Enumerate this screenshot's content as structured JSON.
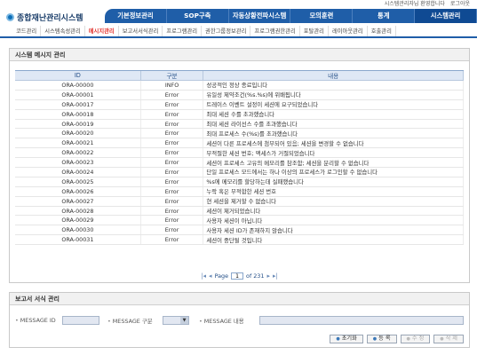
{
  "top_links": [
    "시스템관리자님 환영합니다",
    "로그아웃"
  ],
  "app_title": "종합재난관리시스템",
  "main_nav": [
    {
      "label": "기본정보관리",
      "active": false
    },
    {
      "label": "SOP구축",
      "active": false
    },
    {
      "label": "자동상황전파시스템",
      "active": false
    },
    {
      "label": "모의훈련",
      "active": false
    },
    {
      "label": "통계",
      "active": false
    },
    {
      "label": "시스템관리",
      "active": true
    }
  ],
  "sub_nav": [
    {
      "label": "코드관리",
      "active": false
    },
    {
      "label": "시스템속성관리",
      "active": false
    },
    {
      "label": "메시지관리",
      "active": true
    },
    {
      "label": "보고서서식관리",
      "active": false
    },
    {
      "label": "프로그램관리",
      "active": false
    },
    {
      "label": "권한그룹정보관리",
      "active": false
    },
    {
      "label": "프로그램권한관리",
      "active": false
    },
    {
      "label": "포탈관리",
      "active": false
    },
    {
      "label": "레이아웃관리",
      "active": false
    },
    {
      "label": "호출관리",
      "active": false
    }
  ],
  "panel1": {
    "title": "시스템 메시지 관리",
    "columns": [
      "ID",
      "구분",
      "내용"
    ],
    "rows": [
      [
        "ORA-00000",
        "INFO",
        "성공적인 정상 종료입니다"
      ],
      [
        "ORA-00001",
        "Error",
        "유일성 제약조건(%s.%s)에 위배됩니다"
      ],
      [
        "ORA-00017",
        "Error",
        "트레이스 이벤트 설정이 세션에 요구되었습니다"
      ],
      [
        "ORA-00018",
        "Error",
        "최대 세션 수를 초과했습니다"
      ],
      [
        "ORA-00019",
        "Error",
        "최대 세션 라이선스 수를 초과했습니다"
      ],
      [
        "ORA-00020",
        "Error",
        "최대 프로세스 수(%s)를 초과했습니다"
      ],
      [
        "ORA-00021",
        "Error",
        "세션이 다른 프로세스에 첨부되어 있음; 세션을 변경할 수 없습니다"
      ],
      [
        "ORA-00022",
        "Error",
        "부적절한 세션 번호; 액세스가 거절되었습니다"
      ],
      [
        "ORA-00023",
        "Error",
        "세션이 프로세스 고유의 메모리를 참조함; 세션을 분리할 수 없습니다"
      ],
      [
        "ORA-00024",
        "Error",
        "단일 프로세스 모드에서는 하나 이상의 프로세스가 로그인할 수 없습니다"
      ],
      [
        "ORA-00025",
        "Error",
        "%s에 메모리를 할당하는데 실패했습니다"
      ],
      [
        "ORA-00026",
        "Error",
        "누락 혹은 부적합한 세션 번호"
      ],
      [
        "ORA-00027",
        "Error",
        "현 세션을 제거할 수 없습니다"
      ],
      [
        "ORA-00028",
        "Error",
        "세션이 제거되었습니다"
      ],
      [
        "ORA-00029",
        "Error",
        "사용자 세션이 아닙니다"
      ],
      [
        "ORA-00030",
        "Error",
        "사용자 세션 ID가 존재하지 않습니다"
      ],
      [
        "ORA-00031",
        "Error",
        "세션이 중단될 것입니다"
      ]
    ],
    "pager": {
      "prefix": "Page",
      "current": "1",
      "suffix": "of 231"
    }
  },
  "panel2": {
    "title": "보고서 서식 관리",
    "label_id": "MESSAGE ID",
    "label_type": "MESSAGE 구분",
    "label_content": "MESSAGE 내용",
    "buttons": [
      {
        "label": "초기화",
        "enabled": true
      },
      {
        "label": "등 록",
        "enabled": true
      },
      {
        "label": "수 정",
        "enabled": false
      },
      {
        "label": "삭 제",
        "enabled": false
      }
    ]
  },
  "colors": {
    "nav_blue": "#1f5ea8",
    "active_sub": "#e3342f",
    "grid_header": "#dfe8f5"
  }
}
